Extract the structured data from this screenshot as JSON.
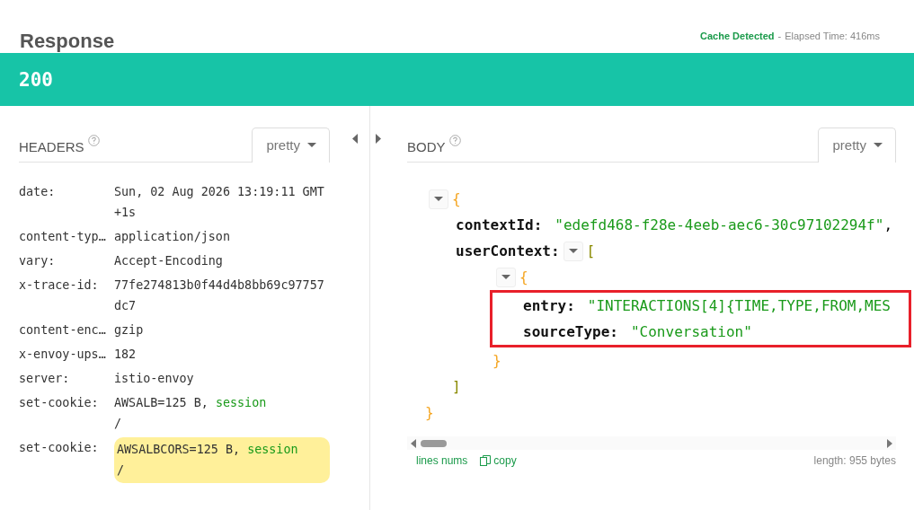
{
  "title": "Response",
  "cache_status": "Cache Detected",
  "separator": "-",
  "elapsed": "Elapsed Time: 416ms",
  "status_code": "200",
  "headers_panel": {
    "title": "HEADERS",
    "format": "pretty",
    "rows": [
      {
        "name": "date:",
        "value": [
          "Sun, 02 Aug 2026 13:19:11 GMT",
          " +1s"
        ]
      },
      {
        "name": "content-typ…",
        "value": [
          "application/json"
        ]
      },
      {
        "name": "vary:",
        "value": [
          "Accept-Encoding"
        ]
      },
      {
        "name": "x-trace-id:",
        "value": [
          "77fe274813b0f44d4b8bb69c97757",
          "dc7"
        ]
      },
      {
        "name": "content-enc…",
        "value": [
          "gzip"
        ]
      },
      {
        "name": "x-envoy-ups…",
        "value": [
          "182"
        ]
      },
      {
        "name": "server:",
        "value": [
          "istio-envoy"
        ]
      },
      {
        "name": "set-cookie:",
        "value": [
          "AWSALB=125 B,",
          "/"
        ],
        "flag": "session"
      },
      {
        "name": "set-cookie:",
        "value": [
          "AWSALBCORS=125 B,",
          "/"
        ],
        "flag": "session",
        "highlighted": true
      }
    ]
  },
  "body_panel": {
    "title": "BODY",
    "format": "pretty",
    "tree": {
      "kind": "object",
      "open": "{",
      "close": "}",
      "expanded": true,
      "children": [
        {
          "kind": "field",
          "key": "contextId:",
          "value": "\"edefd468-f28e-4eeb-aec6-30c97102294f\"",
          "suffix": ","
        },
        {
          "kind": "array",
          "key": "userContext:",
          "open": "[",
          "close": "]",
          "expanded": true,
          "children": [
            {
              "kind": "object",
              "open": "{",
              "close": "}",
              "expanded": true,
              "highlighted": true,
              "children": [
                {
                  "kind": "field",
                  "key": "entry:",
                  "value": "\"INTERACTIONS[4]{TIME,TYPE,FROM,MES"
                },
                {
                  "kind": "field",
                  "key": "sourceType:",
                  "value": "\"Conversation\""
                }
              ]
            }
          ]
        }
      ]
    },
    "footer": {
      "line_numbers": "lines nums",
      "copy": "copy",
      "length": "length: 955 bytes"
    }
  }
}
